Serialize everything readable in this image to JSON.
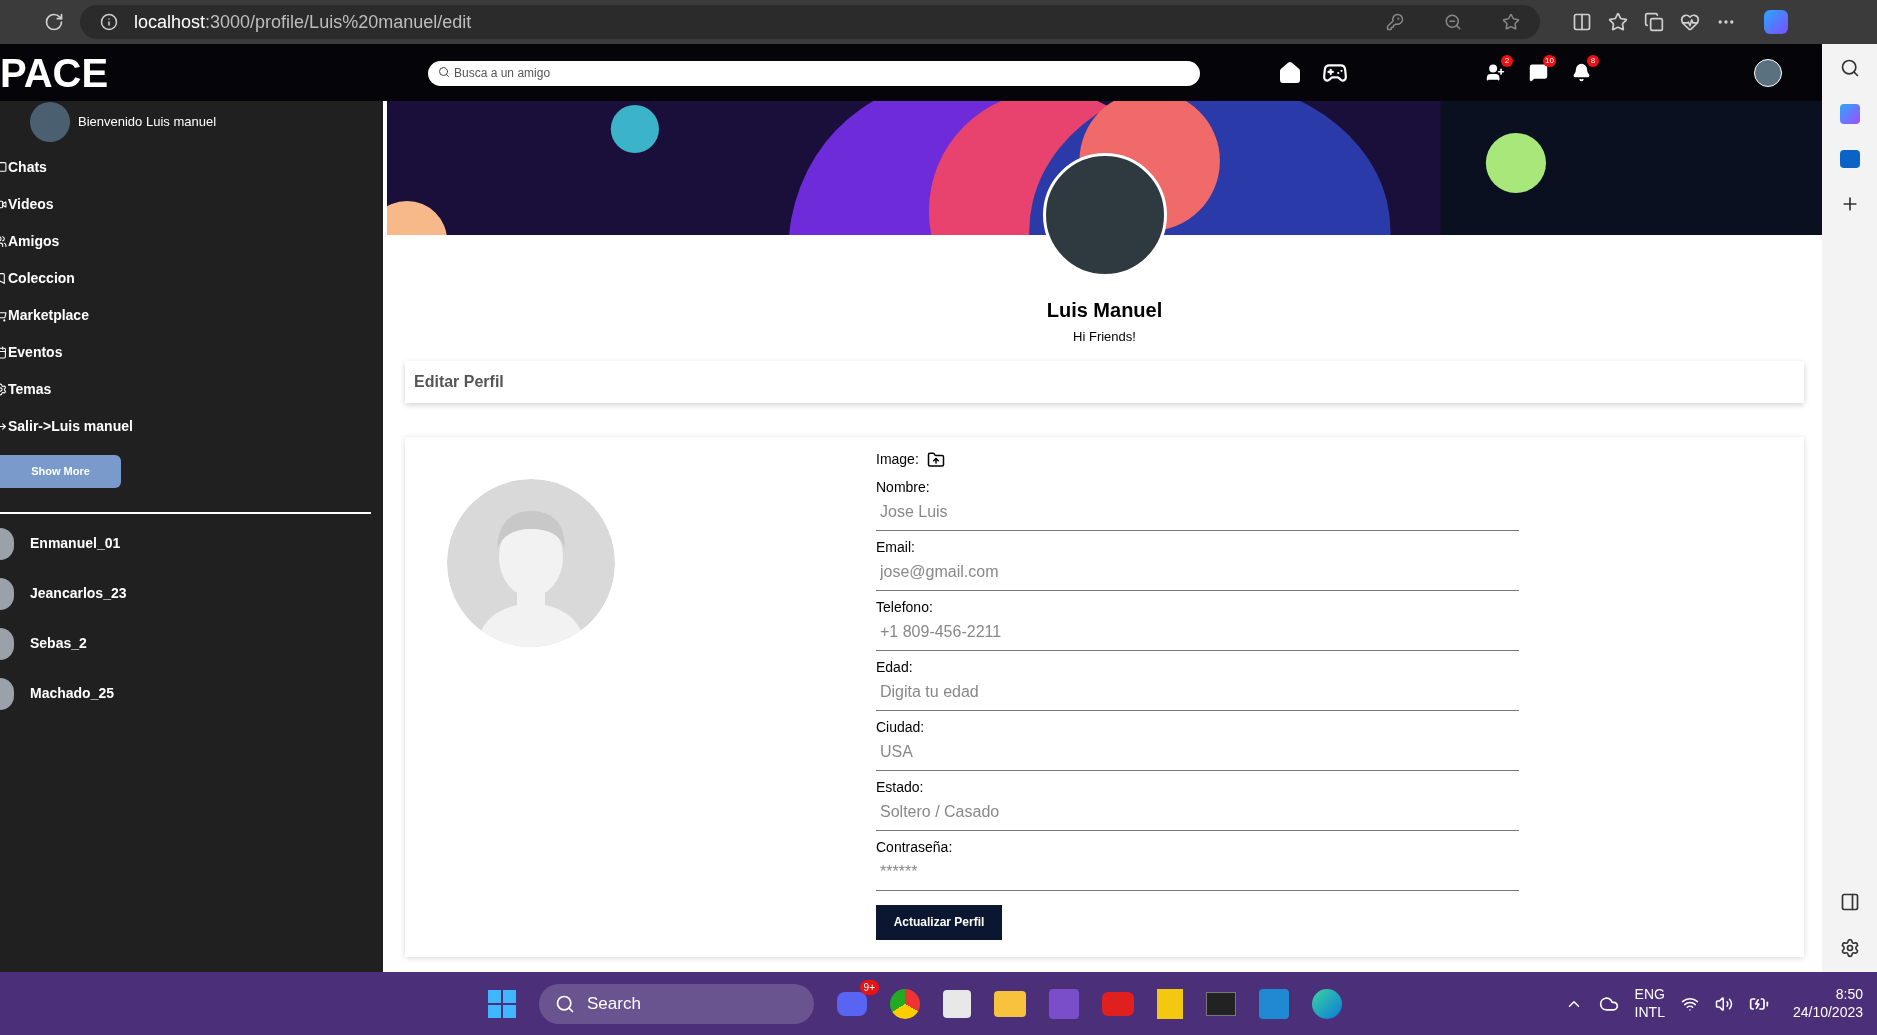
{
  "browser": {
    "address_host": "localhost",
    "address_path": ":3000/profile/Luis%20manuel/edit"
  },
  "app": {
    "logo": "PACE",
    "search": {
      "placeholder": "Busca a un amigo"
    },
    "badges": [
      {
        "kind": "friends",
        "count": "2"
      },
      {
        "kind": "chat",
        "count": "10"
      },
      {
        "kind": "bell",
        "count": "8"
      }
    ]
  },
  "sidebar": {
    "welcome": "Bienvenido Luis manuel",
    "items": [
      {
        "kind": "chat",
        "label": "Chats"
      },
      {
        "kind": "video",
        "label": "Videos"
      },
      {
        "kind": "friends",
        "label": "Amigos"
      },
      {
        "kind": "collection",
        "label": "Coleccion"
      },
      {
        "kind": "market",
        "label": "Marketplace"
      },
      {
        "kind": "events",
        "label": "Eventos"
      },
      {
        "kind": "themes",
        "label": "Temas"
      },
      {
        "kind": "logout",
        "label": "Salir->Luis manuel"
      }
    ],
    "show_more": "Show More",
    "friends": [
      {
        "name": "Enmanuel_01"
      },
      {
        "name": "Jeancarlos_23"
      },
      {
        "name": "Sebas_2"
      },
      {
        "name": "Machado_25"
      }
    ]
  },
  "profile": {
    "name": "Luis Manuel",
    "bio": "Hi Friends!"
  },
  "edit_header": "Editar Perfil",
  "form": {
    "image_label": "Image:",
    "fields": [
      {
        "label": "Nombre:",
        "placeholder": "Jose Luis"
      },
      {
        "label": "Email:",
        "placeholder": "jose@gmail.com"
      },
      {
        "label": "Telefono:",
        "placeholder": "+1 809-456-2211"
      },
      {
        "label": "Edad:",
        "placeholder": "Digita tu edad"
      },
      {
        "label": "Ciudad:",
        "placeholder": "USA"
      },
      {
        "label": "Estado:",
        "placeholder": "Soltero / Casado"
      },
      {
        "label": "Contraseña:",
        "placeholder": "******"
      }
    ],
    "submit": "Actualizar Perfil"
  },
  "taskbar": {
    "search": "Search",
    "chat_badge": "9+",
    "lang": "ENG",
    "layout": "INTL",
    "time": "8:50",
    "date": "24/10/2023"
  }
}
